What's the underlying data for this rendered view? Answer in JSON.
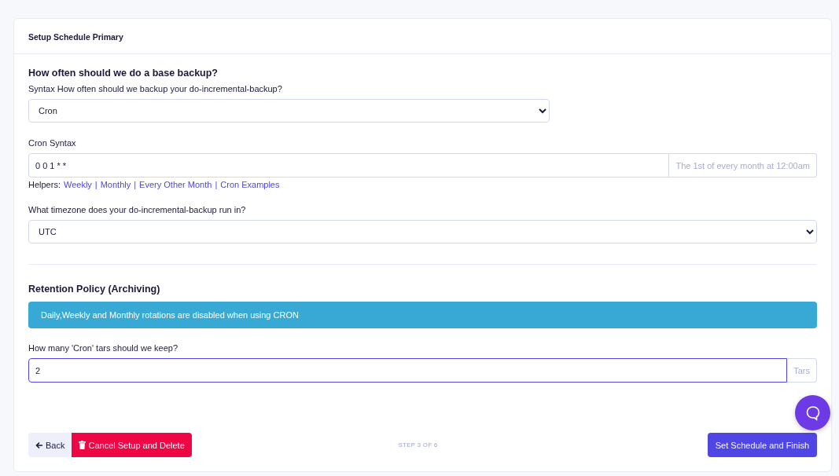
{
  "card_title": "Setup Schedule Primary",
  "base_backup": {
    "heading": "How often should we do a base backup?",
    "syntax_label": "Syntax How often should we backup your do-incremental-backup?",
    "syntax_value": "Cron",
    "cron_label": "Cron Syntax",
    "cron_value": "0 0 1 * *",
    "cron_addon": "The 1st of every month at 12:00am",
    "helpers_label": "Helpers:",
    "helper_separator": "|",
    "helpers": [
      "Weekly",
      "Monthly",
      "Every Other Month",
      "Cron Examples"
    ],
    "timezone_label": "What timezone does your do-incremental-backup run in?",
    "timezone_value": "UTC"
  },
  "retention": {
    "heading": "Retention Policy (Archiving)",
    "alert": "Daily,Weekly and Monthly rotations are disabled when using CRON",
    "keep_label": "How many 'Cron' tars should we keep?",
    "keep_value": "2",
    "keep_addon": "Tars"
  },
  "footer": {
    "back": "Back",
    "cancel": "Cancel Setup and Delete",
    "step": "STEP 3 OF 6",
    "finish": "Set Schedule and Finish"
  }
}
